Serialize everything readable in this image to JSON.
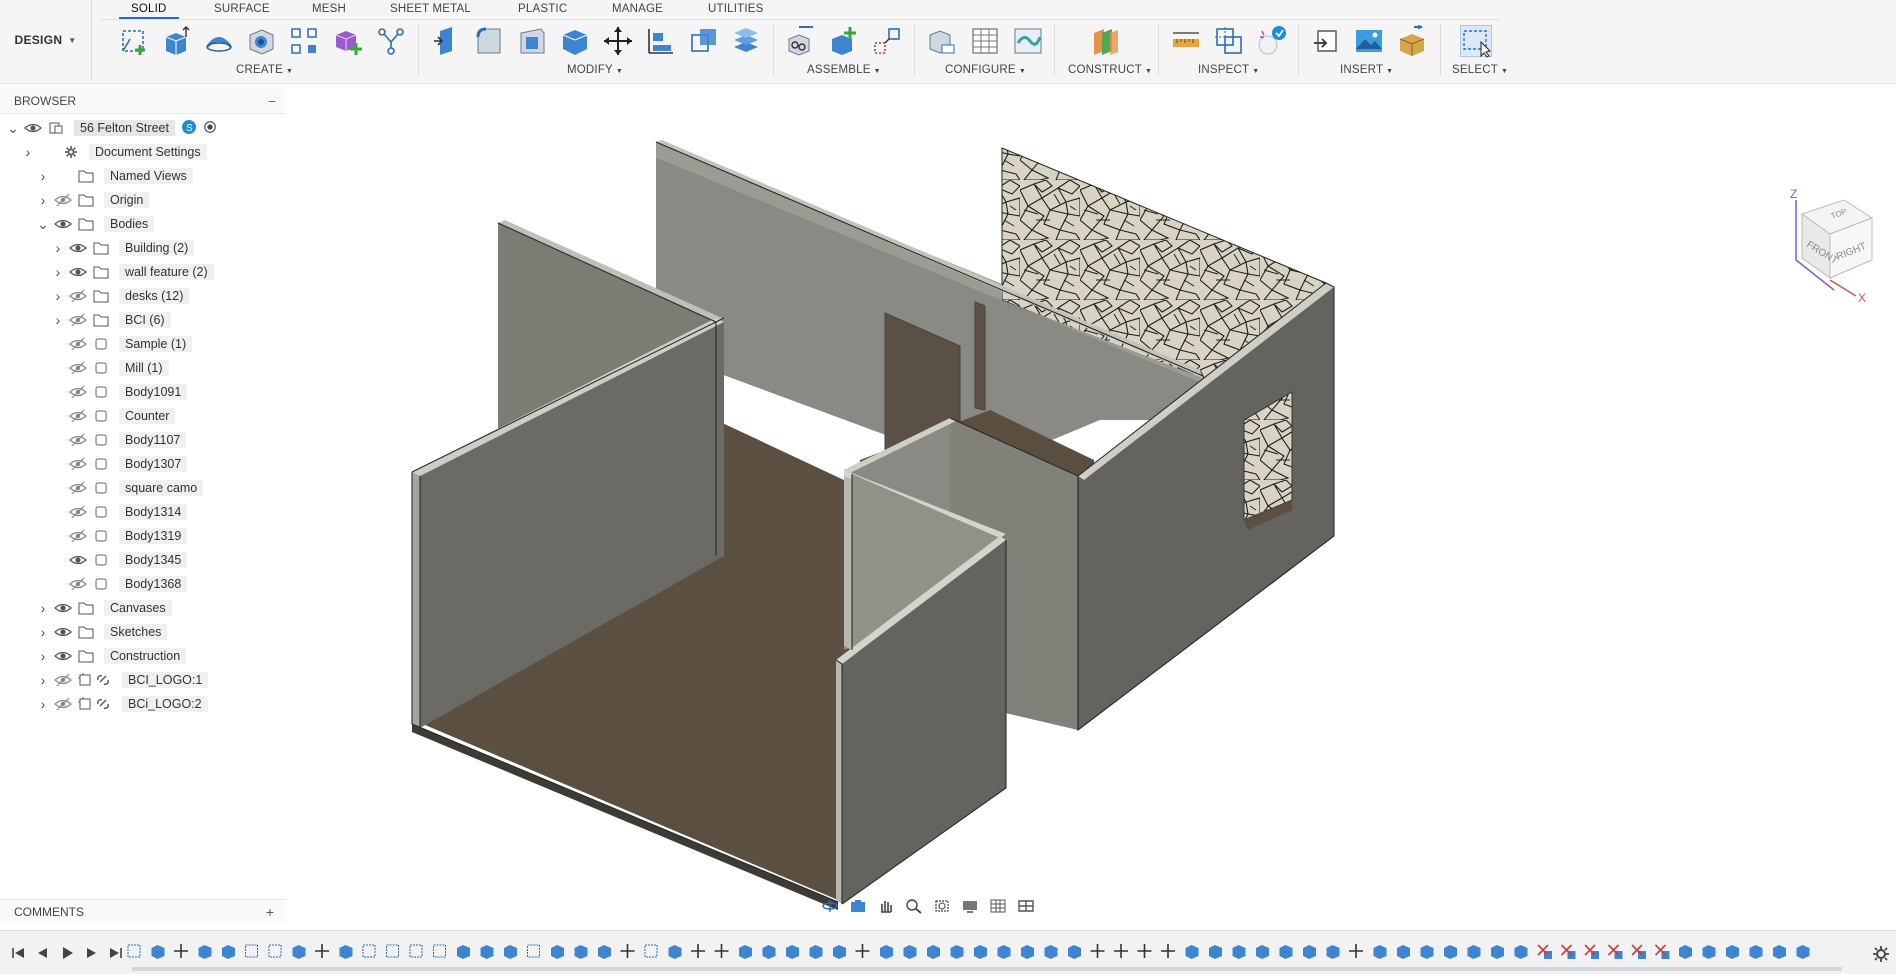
{
  "workspace": {
    "label": "DESIGN"
  },
  "tabs": [
    {
      "label": "SOLID",
      "active": true
    },
    {
      "label": "SURFACE"
    },
    {
      "label": "MESH"
    },
    {
      "label": "SHEET METAL"
    },
    {
      "label": "PLASTIC"
    },
    {
      "label": "MANAGE"
    },
    {
      "label": "UTILITIES"
    }
  ],
  "groups": {
    "create": "CREATE",
    "modify": "MODIFY",
    "assemble": "ASSEMBLE",
    "configure": "CONFIGURE",
    "construct": "CONSTRUCT",
    "inspect": "INSPECT",
    "insert": "INSERT",
    "select": "SELECT"
  },
  "browser": {
    "title": "BROWSER",
    "root": "56 Felton Street",
    "items": [
      {
        "label": "Document Settings",
        "icon": "gear-icon"
      },
      {
        "label": "Named Views",
        "icon": "folder-icon"
      },
      {
        "label": "Origin",
        "icon": "folder-icon",
        "visible": false
      },
      {
        "label": "Bodies",
        "icon": "folder-icon",
        "visible": true,
        "expanded": true
      },
      {
        "label": "Building (2)",
        "icon": "folder-icon",
        "visible": true
      },
      {
        "label": "wall feature (2)",
        "icon": "folder-icon",
        "visible": true
      },
      {
        "label": "desks (12)",
        "icon": "folder-icon",
        "visible": false
      },
      {
        "label": "BCI (6)",
        "icon": "folder-icon",
        "visible": false
      },
      {
        "label": "Sample (1)",
        "icon": "body-icon",
        "visible": false
      },
      {
        "label": "Mill (1)",
        "icon": "body-icon",
        "visible": false
      },
      {
        "label": "Body1091",
        "icon": "body-icon",
        "visible": false
      },
      {
        "label": "Counter",
        "icon": "body-icon",
        "visible": false
      },
      {
        "label": "Body1107",
        "icon": "body-icon",
        "visible": false
      },
      {
        "label": "Body1307",
        "icon": "body-icon",
        "visible": false
      },
      {
        "label": "square camo",
        "icon": "body-icon",
        "visible": false
      },
      {
        "label": "Body1314",
        "icon": "body-icon",
        "visible": false
      },
      {
        "label": "Body1319",
        "icon": "body-icon",
        "visible": false
      },
      {
        "label": "Body1345",
        "icon": "body-icon",
        "visible": true
      },
      {
        "label": "Body1368",
        "icon": "body-icon",
        "visible": false
      },
      {
        "label": "Canvases",
        "icon": "folder-icon",
        "visible": true
      },
      {
        "label": "Sketches",
        "icon": "folder-icon",
        "visible": true
      },
      {
        "label": "Construction",
        "icon": "folder-icon",
        "visible": true
      },
      {
        "label": "BCI_LOGO:1",
        "icon": "component-link-icon",
        "visible": false
      },
      {
        "label": "BCi_LOGO:2",
        "icon": "component-link-icon",
        "visible": false
      }
    ]
  },
  "comments": {
    "title": "COMMENTS"
  },
  "viewcube": {
    "top": "TOP",
    "front": "FRONT",
    "right": "RIGHT",
    "x_axis": "X",
    "z_axis": "Z"
  },
  "colors": {
    "accent": "#1b6fc8",
    "wall": "#6d6c66",
    "floor": "#5a4f42"
  }
}
